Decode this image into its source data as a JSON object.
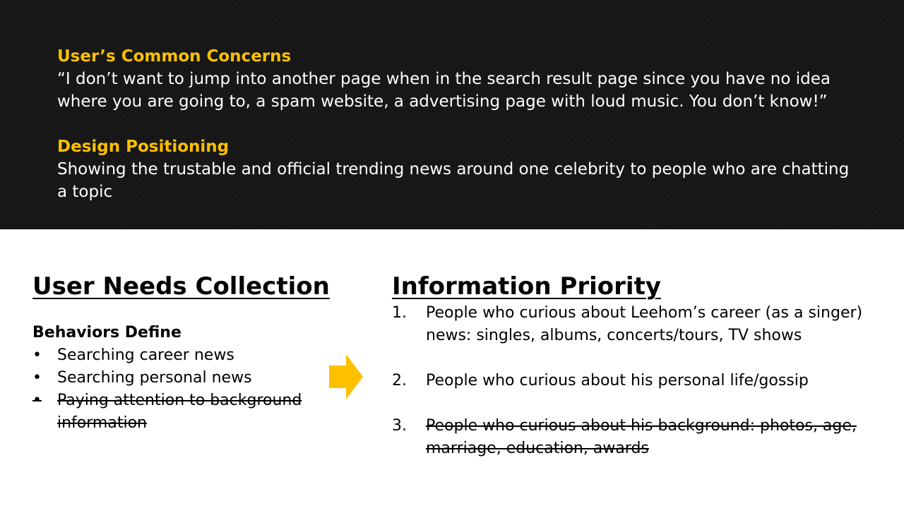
{
  "top": {
    "concerns_heading": "User’s Common Concerns",
    "concerns_quote": "“I don’t want to jump into another page when in the search result page since you have no idea where you are going to, a spam website, a advertising page with loud music. You don’t know!”",
    "positioning_heading": "Design Positioning",
    "positioning_text": "Showing the trustable and official trending news around one celebrity to people who are chatting a topic"
  },
  "left": {
    "title": "User Needs Collection",
    "subheading": "Behaviors Define",
    "bullets": [
      {
        "marker": "•",
        "text": "Searching career news",
        "struck": false
      },
      {
        "marker": "•",
        "text": "Searching personal news",
        "struck": false
      },
      {
        "marker": "•",
        "text": "Paying attention to background information",
        "struck": true
      }
    ]
  },
  "right": {
    "title": "Information Priority",
    "items": [
      {
        "number": "1.",
        "text": "People who curious about Leehom’s career (as a singer) news: singles, albums, concerts/tours, TV shows",
        "struck": false
      },
      {
        "number": "2.",
        "text": "People who curious about his personal life/gossip",
        "struck": false
      },
      {
        "number": "3.",
        "text": "People who curious about his background: photos, age, marriage, education, awards",
        "struck": true
      }
    ]
  },
  "colors": {
    "accent": "#FFC000",
    "dark_band": "#141414"
  },
  "icons": {
    "arrow": "right-arrow-icon"
  }
}
